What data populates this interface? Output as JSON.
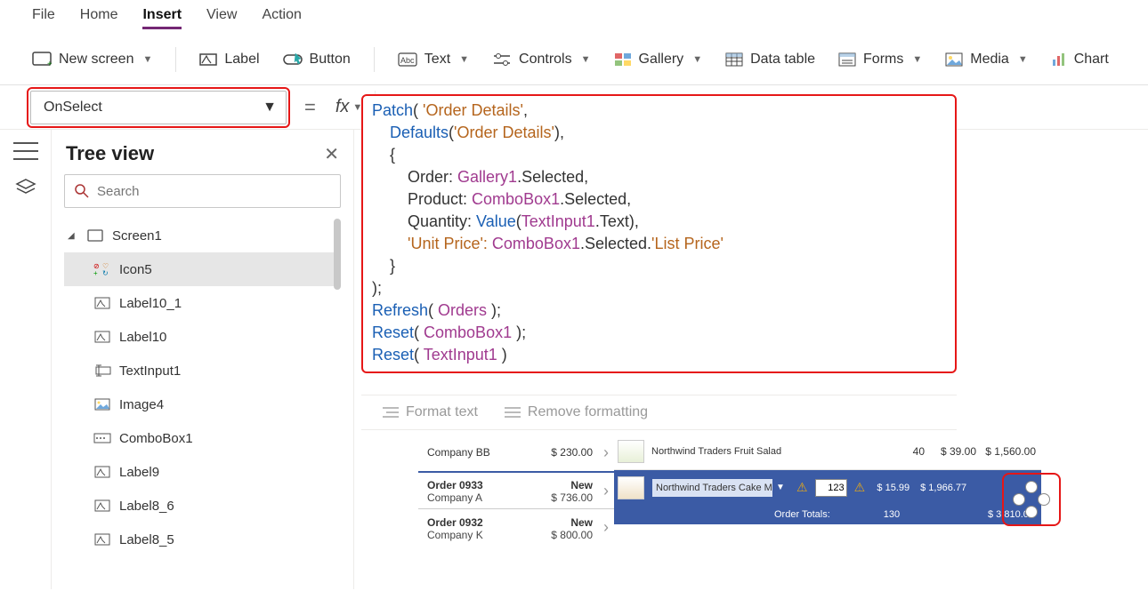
{
  "menu": {
    "file": "File",
    "home": "Home",
    "insert": "Insert",
    "view": "View",
    "action": "Action"
  },
  "ribbon": {
    "new_screen": "New screen",
    "label": "Label",
    "button": "Button",
    "text": "Text",
    "controls": "Controls",
    "gallery": "Gallery",
    "data_table": "Data table",
    "forms": "Forms",
    "media": "Media",
    "chart": "Chart"
  },
  "property": {
    "selected": "OnSelect",
    "fx": "fx"
  },
  "tree": {
    "title": "Tree view",
    "search_placeholder": "Search",
    "items": [
      "Screen1",
      "Icon5",
      "Label10_1",
      "Label10",
      "TextInput1",
      "Image4",
      "ComboBox1",
      "Label9",
      "Label8_6",
      "Label8_5"
    ]
  },
  "formula": {
    "l1a": "Patch",
    "l1b": "( ",
    "l1c": "'Order Details'",
    "l1d": ",",
    "l2a": "    Defaults",
    "l2b": "(",
    "l2c": "'Order Details'",
    "l2d": "),",
    "l3": "    {",
    "l4a": "        Order: ",
    "l4b": "Gallery1",
    "l4c": ".Selected,",
    "l5a": "        Product: ",
    "l5b": "ComboBox1",
    "l5c": ".Selected,",
    "l6a": "        Quantity: ",
    "l6b": "Value",
    "l6c": "(",
    "l6d": "TextInput1",
    "l6e": ".Text),",
    "l7a": "        'Unit Price': ",
    "l7b": "ComboBox1",
    "l7c": ".Selected.",
    "l7d": "'List Price'",
    "l8": "    }",
    "l9": ");",
    "l10a": "Refresh",
    "l10b": "( ",
    "l10c": "Orders",
    "l10d": " );",
    "l11a": "Reset",
    "l11b": "( ",
    "l11c": "ComboBox1",
    "l11d": " );",
    "l12a": "Reset",
    "l12b": "( ",
    "l12c": "TextInput1",
    "l12d": " )"
  },
  "formatbar": {
    "format": "Format text",
    "remove": "Remove formatting"
  },
  "preview": {
    "orders": [
      {
        "l1a": "Company BB",
        "l1b": "$ 230.00"
      },
      {
        "l1a": "Order 0933",
        "l1b": "New",
        "l2a": "Company A",
        "l2b": "$ 736.00"
      },
      {
        "l1a": "Order 0932",
        "l1b": "New",
        "l2a": "Company K",
        "l2b": "$ 800.00"
      }
    ],
    "line1": {
      "name": "Northwind Traders Fruit Salad",
      "qty": "40",
      "price": "$ 39.00",
      "total": "$ 1,560.00"
    },
    "line2": {
      "combo": "Northwind Traders Cake Mix",
      "qty": "123",
      "price": "$ 15.99",
      "total": "$ 1,966.77"
    },
    "totals": {
      "label": "Order Totals:",
      "qty": "130",
      "amount": "$ 3,810.00"
    }
  }
}
